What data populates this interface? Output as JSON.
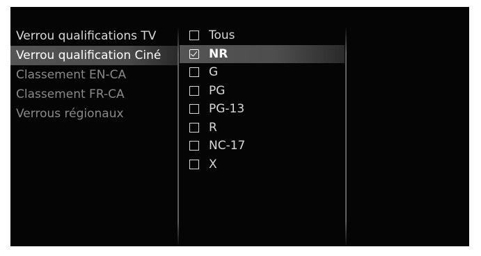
{
  "menu": {
    "items": [
      {
        "label": "Verrou qualifications TV"
      },
      {
        "label": "Verrou qualification Ciné"
      },
      {
        "label": "Classement EN-CA"
      },
      {
        "label": "Classement FR-CA"
      },
      {
        "label": "Verrous régionaux"
      }
    ],
    "selected_index": 1
  },
  "ratings": {
    "options": [
      {
        "label": "Tous",
        "checked": false
      },
      {
        "label": "NR",
        "checked": true
      },
      {
        "label": "G",
        "checked": false
      },
      {
        "label": "PG",
        "checked": false
      },
      {
        "label": "PG-13",
        "checked": false
      },
      {
        "label": "R",
        "checked": false
      },
      {
        "label": "NC-17",
        "checked": false
      },
      {
        "label": "X",
        "checked": false
      }
    ],
    "selected_index": 1
  }
}
